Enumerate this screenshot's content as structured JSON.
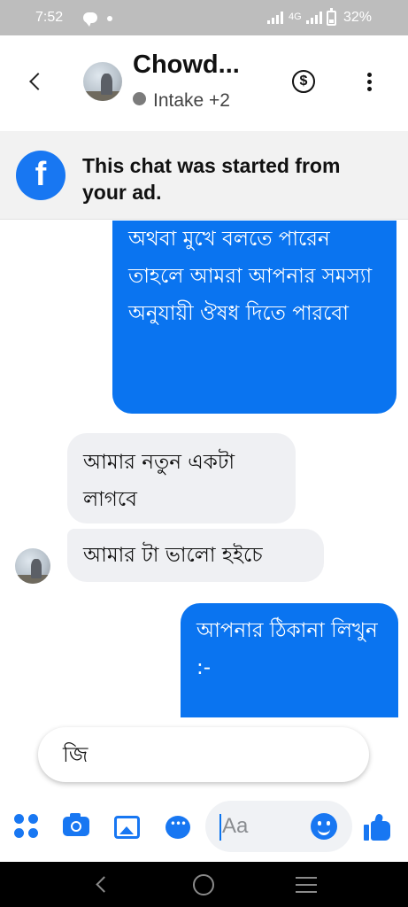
{
  "status_bar": {
    "time": "7:52",
    "network": "4G",
    "battery": "32%"
  },
  "header": {
    "contact_name": "Chowd...",
    "subtitle": "Intake +2",
    "dollar_symbol": "$"
  },
  "ad_banner": {
    "text": "This chat was started from your ad."
  },
  "messages": [
    {
      "direction": "outgoing",
      "text": "অথবা মুখে বলতে পারেন তাহলে আমরা আপনার সমস্যা অনুযায়ী ঔষধ দিতে পারবো"
    },
    {
      "direction": "incoming",
      "text": "আমার নতুন একটা লাগবে"
    },
    {
      "direction": "incoming",
      "text": "আমার টা ভালো হইচে"
    },
    {
      "direction": "outgoing",
      "text": "আপনার ঠিকানা লিখুন :-"
    }
  ],
  "quick_reply": {
    "text": "জি"
  },
  "composer": {
    "placeholder": "Aa"
  },
  "colors": {
    "accent": "#1877f2",
    "outgoing_bubble": "#0a74f0",
    "incoming_bubble": "#eff0f3"
  }
}
